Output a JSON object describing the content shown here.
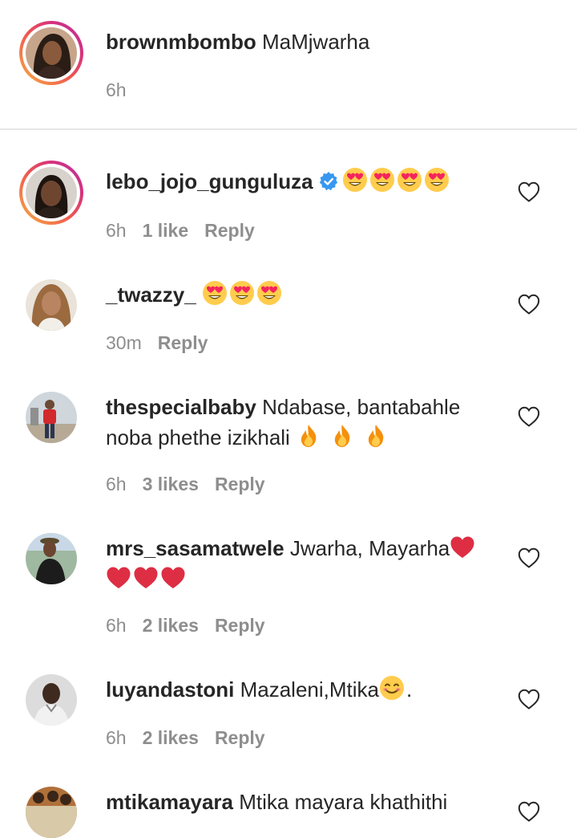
{
  "caption": {
    "username": "brownmbombo",
    "text": " MaMjwarha",
    "time": "6h"
  },
  "comments": [
    {
      "username": "lebo_jojo_gunguluza",
      "verified": true,
      "text": "",
      "emoji": [
        "heart-eyes",
        "heart-eyes",
        "heart-eyes",
        "heart-eyes"
      ],
      "time": "6h",
      "likes": "1 like",
      "reply": "Reply"
    },
    {
      "username": "_twazzy_",
      "text": " ",
      "emoji": [
        "heart-eyes",
        "heart-eyes",
        "heart-eyes"
      ],
      "time": "30m",
      "reply": "Reply"
    },
    {
      "username": "thespecialbaby",
      "text": " Ndabase, bantabahle",
      "text_line2": "noba phethe izikhali ",
      "emoji": [
        "fire",
        "fire",
        "fire"
      ],
      "time": "6h",
      "likes": "3 likes",
      "reply": "Reply"
    },
    {
      "username": "mrs_sasamatwele",
      "text": " Jwarha, Mayarha",
      "emoji": [
        "red-heart",
        "red-heart",
        "red-heart",
        "red-heart"
      ],
      "time": "6h",
      "likes": "2 likes",
      "reply": "Reply"
    },
    {
      "username": "luyandastoni",
      "text": " Mazaleni,Mtika",
      "text_after": ".",
      "emoji": [
        "smiling-face"
      ],
      "time": "6h",
      "likes": "2 likes",
      "reply": "Reply"
    },
    {
      "username": "mtikamayara",
      "text": " Mtika mayara khathithi"
    }
  ],
  "icons": {
    "like": "heart-outline-icon",
    "verified": "verified-badge-icon"
  },
  "colors": {
    "text": "#262626",
    "meta": "#8e8e8e",
    "verified": "#3897f0",
    "story_ring_start": "#f7b043",
    "story_ring_end": "#b33aa0"
  }
}
